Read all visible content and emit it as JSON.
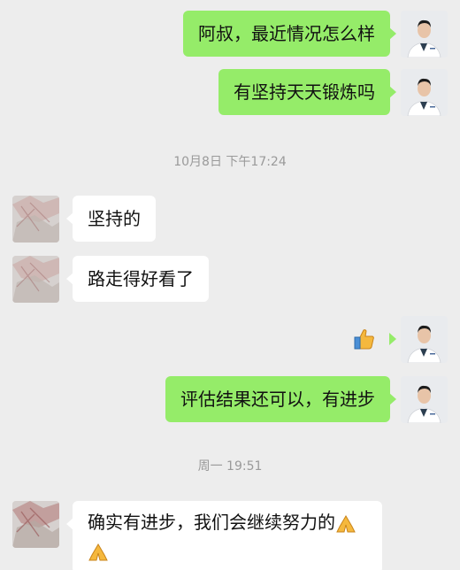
{
  "messages": [
    {
      "id": "m1",
      "side": "right",
      "text": "阿叔，最近情况怎么样"
    },
    {
      "id": "m2",
      "side": "right",
      "text": "有坚持天天锻炼吗"
    },
    {
      "id": "m3",
      "side": "left",
      "text": "坚持的"
    },
    {
      "id": "m4",
      "side": "left",
      "text": "路走得好看了"
    },
    {
      "id": "m5",
      "side": "right",
      "icon": "thumbs-up-emoji"
    },
    {
      "id": "m6",
      "side": "right",
      "text": "评估结果还可以，有进步"
    },
    {
      "id": "m7",
      "side": "left",
      "text": "确实有进步，我们会继续努力的",
      "icon": "folded-hands-emoji"
    }
  ],
  "timestamps": {
    "t1": "10月8日 下午17:24",
    "t2": "周一 19:51"
  },
  "colors": {
    "background": "#ededed",
    "sent_bubble": "#95ec69",
    "received_bubble": "#ffffff",
    "timestamp_text": "#9a9a9a"
  },
  "avatars": {
    "doctor": "doctor-avatar",
    "patient": "patient-avatar"
  }
}
